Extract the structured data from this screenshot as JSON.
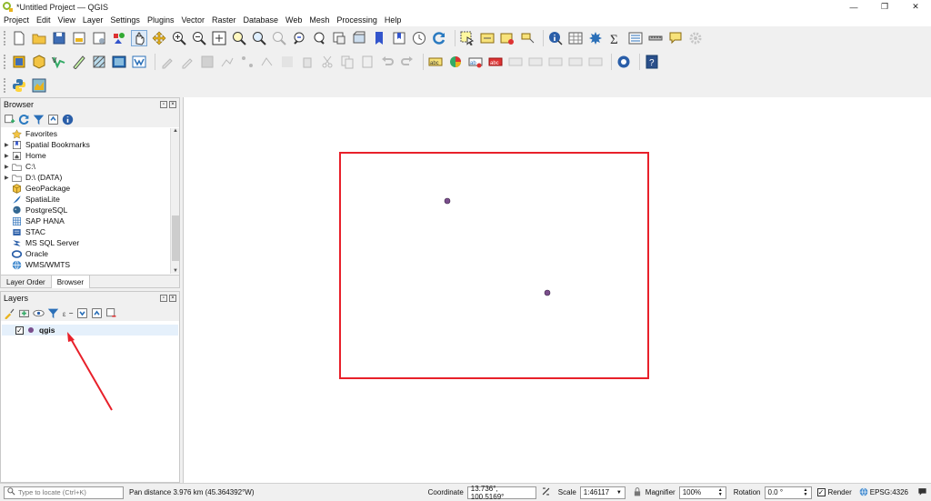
{
  "window": {
    "title": "*Untitled Project — QGIS"
  },
  "menubar": [
    "Project",
    "Edit",
    "View",
    "Layer",
    "Settings",
    "Plugins",
    "Vector",
    "Raster",
    "Database",
    "Web",
    "Mesh",
    "Processing",
    "Help"
  ],
  "browser": {
    "title": "Browser",
    "items": [
      {
        "label": "Favorites",
        "icon": "star-icon"
      },
      {
        "label": "Spatial Bookmarks",
        "icon": "bookmark-icon"
      },
      {
        "label": "Home",
        "icon": "home-folder-icon"
      },
      {
        "label": "C:\\",
        "icon": "folder-icon"
      },
      {
        "label": "D:\\ (DATA)",
        "icon": "folder-icon"
      },
      {
        "label": "GeoPackage",
        "icon": "geopackage-icon"
      },
      {
        "label": "SpatiaLite",
        "icon": "spatialite-icon"
      },
      {
        "label": "PostgreSQL",
        "icon": "postgresql-icon"
      },
      {
        "label": "SAP HANA",
        "icon": "sap-hana-icon"
      },
      {
        "label": "STAC",
        "icon": "stac-icon"
      },
      {
        "label": "MS SQL Server",
        "icon": "mssql-icon"
      },
      {
        "label": "Oracle",
        "icon": "oracle-icon"
      },
      {
        "label": "WMS/WMTS",
        "icon": "wms-icon"
      }
    ],
    "tabs": [
      "Layer Order",
      "Browser"
    ]
  },
  "layers": {
    "title": "Layers",
    "items": [
      {
        "name": "qgis",
        "checked": true
      }
    ]
  },
  "statusbar": {
    "locate_placeholder": "Type to locate (Ctrl+K)",
    "message": "Pan distance 3.976 km (45.364392°W)",
    "coordinate_label": "Coordinate",
    "coordinate_value": "13.736°, 100.5169°",
    "scale_label": "Scale",
    "scale_value": "1:46117",
    "magnifier_label": "Magnifier",
    "magnifier_value": "100%",
    "rotation_label": "Rotation",
    "rotation_value": "0.0 °",
    "render_label": "Render",
    "crs": "EPSG:4326"
  },
  "colors": {
    "annotation_red": "#e8202a",
    "point_fill": "#7a4e8c",
    "selection_blue": "#e5f0fb"
  }
}
